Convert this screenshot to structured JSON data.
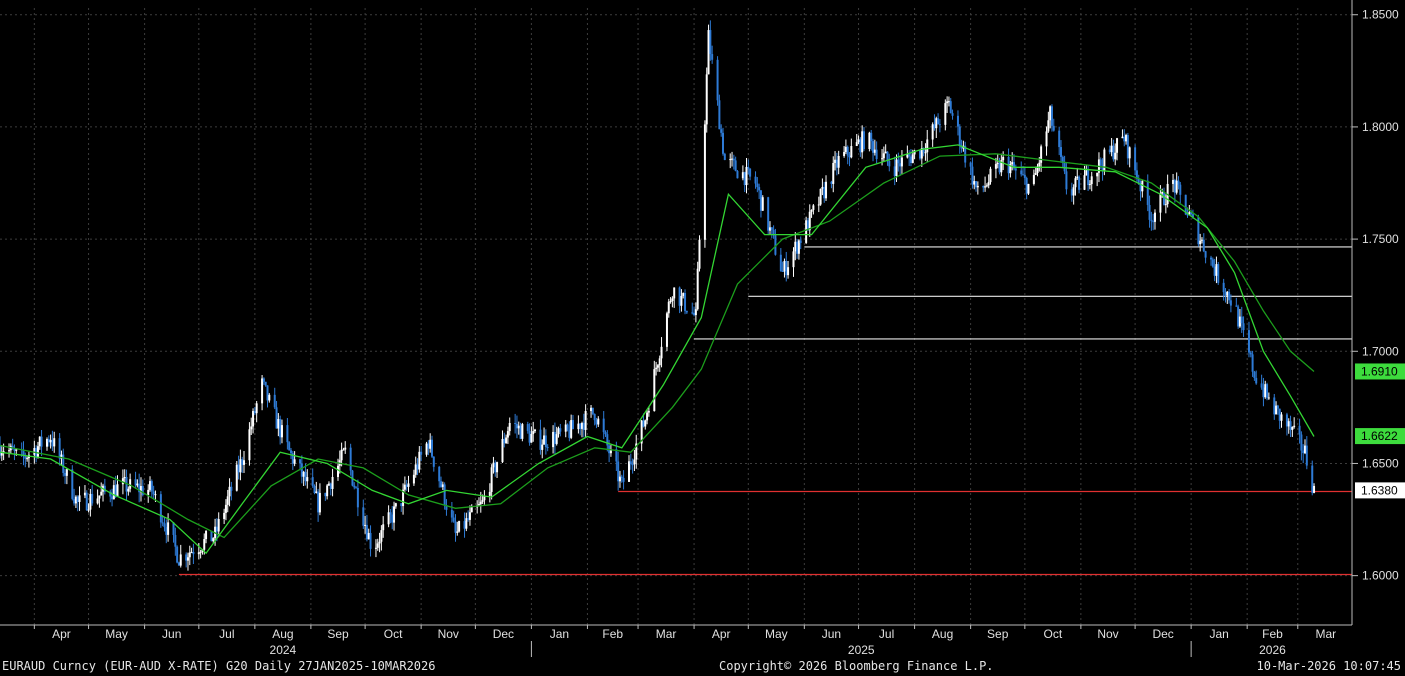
{
  "footer": {
    "left": "EURAUD Curncy (EUR-AUD X-RATE) G20 Daily 27JAN2025-10MAR2026",
    "center": "Copyright© 2026 Bloomberg Finance L.P.",
    "right": "10-Mar-2026 10:07:45"
  },
  "colors": {
    "background": "#000000",
    "grid": "#3c3c3c",
    "candle_up": "#ffffff",
    "candle_down": "#2e7bd6",
    "ma_fast": "#33d633",
    "ma_slow": "#1c9e1c",
    "support_white": "#e8e8e8",
    "support_red": "#e03030",
    "price_tag_green": "#3ddc3d",
    "price_tag_white": "#ffffff"
  },
  "chart_data": {
    "type": "candlestick",
    "ylim": [
      1.578,
      1.853
    ],
    "y_ticks": [
      "1.6000",
      "1.6500",
      "1.7000",
      "1.7500",
      "1.8000",
      "1.8500"
    ],
    "y_tick_values": [
      1.6,
      1.65,
      1.7,
      1.75,
      1.8,
      1.85
    ],
    "months": [
      "Apr",
      "May",
      "Jun",
      "Jul",
      "Aug",
      "Sep",
      "Oct",
      "Nov",
      "Dec",
      "Jan",
      "Feb",
      "Mar",
      "Apr",
      "May",
      "Jun",
      "Jul",
      "Aug",
      "Sep",
      "Oct",
      "Nov",
      "Dec",
      "Jan",
      "Feb",
      "Mar"
    ],
    "years": [
      "2024",
      "2025",
      "2026"
    ],
    "x_range": [
      "2024-03-13",
      "2026-03-31"
    ],
    "price_path": [
      [
        "2024-03-13",
        1.658
      ],
      [
        "2024-03-25",
        1.652
      ],
      [
        "2024-04-10",
        1.662
      ],
      [
        "2024-04-25",
        1.632
      ],
      [
        "2024-05-20",
        1.64
      ],
      [
        "2024-06-05",
        1.638
      ],
      [
        "2024-06-20",
        1.608
      ],
      [
        "2024-07-10",
        1.618
      ],
      [
        "2024-07-25",
        1.652
      ],
      [
        "2024-08-05",
        1.685
      ],
      [
        "2024-08-20",
        1.655
      ],
      [
        "2024-09-05",
        1.632
      ],
      [
        "2024-09-20",
        1.655
      ],
      [
        "2024-10-05",
        1.612
      ],
      [
        "2024-10-20",
        1.632
      ],
      [
        "2024-11-05",
        1.66
      ],
      [
        "2024-11-20",
        1.618
      ],
      [
        "2024-12-05",
        1.632
      ],
      [
        "2024-12-20",
        1.668
      ],
      [
        "2025-01-05",
        1.66
      ],
      [
        "2025-01-20",
        1.663
      ],
      [
        "2025-02-05",
        1.673
      ],
      [
        "2025-02-20",
        1.64
      ],
      [
        "2025-03-05",
        1.67
      ],
      [
        "2025-03-20",
        1.728
      ],
      [
        "2025-04-02",
        1.715
      ],
      [
        "2025-04-09",
        1.84
      ],
      [
        "2025-04-18",
        1.785
      ],
      [
        "2025-05-05",
        1.775
      ],
      [
        "2025-05-20",
        1.735
      ],
      [
        "2025-06-05",
        1.76
      ],
      [
        "2025-06-20",
        1.785
      ],
      [
        "2025-07-05",
        1.795
      ],
      [
        "2025-07-20",
        1.782
      ],
      [
        "2025-08-05",
        1.79
      ],
      [
        "2025-08-20",
        1.81
      ],
      [
        "2025-09-05",
        1.77
      ],
      [
        "2025-09-20",
        1.785
      ],
      [
        "2025-10-05",
        1.772
      ],
      [
        "2025-10-15",
        1.805
      ],
      [
        "2025-10-25",
        1.77
      ],
      [
        "2025-11-10",
        1.782
      ],
      [
        "2025-11-25",
        1.795
      ],
      [
        "2025-12-10",
        1.76
      ],
      [
        "2025-12-22",
        1.775
      ],
      [
        "2026-01-05",
        1.752
      ],
      [
        "2026-01-15",
        1.735
      ],
      [
        "2026-01-25",
        1.72
      ],
      [
        "2026-02-05",
        1.69
      ],
      [
        "2026-02-15",
        1.675
      ],
      [
        "2026-02-25",
        1.665
      ],
      [
        "2026-03-05",
        1.655
      ],
      [
        "2026-03-10",
        1.638
      ]
    ],
    "ma_fast": [
      [
        "2024-03-13",
        1.655
      ],
      [
        "2024-04-10",
        1.652
      ],
      [
        "2024-05-15",
        1.636
      ],
      [
        "2024-06-15",
        1.625
      ],
      [
        "2024-07-05",
        1.61
      ],
      [
        "2024-07-25",
        1.632
      ],
      [
        "2024-08-15",
        1.655
      ],
      [
        "2024-09-10",
        1.65
      ],
      [
        "2024-10-05",
        1.638
      ],
      [
        "2024-10-25",
        1.632
      ],
      [
        "2024-11-15",
        1.638
      ],
      [
        "2024-12-10",
        1.635
      ],
      [
        "2025-01-05",
        1.65
      ],
      [
        "2025-02-01",
        1.662
      ],
      [
        "2025-02-20",
        1.657
      ],
      [
        "2025-03-15",
        1.685
      ],
      [
        "2025-04-05",
        1.715
      ],
      [
        "2025-04-20",
        1.77
      ],
      [
        "2025-05-10",
        1.752
      ],
      [
        "2025-06-05",
        1.752
      ],
      [
        "2025-07-05",
        1.782
      ],
      [
        "2025-08-05",
        1.79
      ],
      [
        "2025-08-25",
        1.792
      ],
      [
        "2025-09-25",
        1.782
      ],
      [
        "2025-10-20",
        1.782
      ],
      [
        "2025-11-20",
        1.78
      ],
      [
        "2025-12-15",
        1.77
      ],
      [
        "2026-01-10",
        1.755
      ],
      [
        "2026-01-25",
        1.735
      ],
      [
        "2026-02-10",
        1.7
      ],
      [
        "2026-02-25",
        1.68
      ],
      [
        "2026-03-10",
        1.662
      ]
    ],
    "ma_slow": [
      [
        "2024-03-13",
        1.658
      ],
      [
        "2024-04-20",
        1.652
      ],
      [
        "2024-05-25",
        1.64
      ],
      [
        "2024-06-25",
        1.625
      ],
      [
        "2024-07-15",
        1.617
      ],
      [
        "2024-08-10",
        1.64
      ],
      [
        "2024-09-05",
        1.652
      ],
      [
        "2024-09-30",
        1.648
      ],
      [
        "2024-10-25",
        1.636
      ],
      [
        "2024-11-20",
        1.63
      ],
      [
        "2024-12-15",
        1.632
      ],
      [
        "2025-01-10",
        1.648
      ],
      [
        "2025-02-05",
        1.657
      ],
      [
        "2025-02-25",
        1.655
      ],
      [
        "2025-03-20",
        1.675
      ],
      [
        "2025-04-05",
        1.692
      ],
      [
        "2025-04-25",
        1.73
      ],
      [
        "2025-05-20",
        1.75
      ],
      [
        "2025-06-15",
        1.758
      ],
      [
        "2025-07-15",
        1.775
      ],
      [
        "2025-08-15",
        1.787
      ],
      [
        "2025-09-15",
        1.788
      ],
      [
        "2025-10-15",
        1.785
      ],
      [
        "2025-11-15",
        1.782
      ],
      [
        "2025-12-10",
        1.775
      ],
      [
        "2026-01-05",
        1.76
      ],
      [
        "2026-01-25",
        1.74
      ],
      [
        "2026-02-10",
        1.718
      ],
      [
        "2026-02-25",
        1.7
      ],
      [
        "2026-03-10",
        1.691
      ]
    ],
    "support_lines": [
      {
        "level": 1.7465,
        "from": "2025-06-01",
        "color": "white"
      },
      {
        "level": 1.7245,
        "from": "2025-05-01",
        "color": "white"
      },
      {
        "level": 1.7055,
        "from": "2025-04-01",
        "color": "white"
      },
      {
        "level": 1.6375,
        "from": "2025-02-18",
        "color": "red"
      },
      {
        "level": 1.6005,
        "from": "2024-06-20",
        "color": "red"
      }
    ],
    "price_labels": [
      {
        "value": "1.6910",
        "level": 1.691,
        "style": "green"
      },
      {
        "value": "1.6622",
        "level": 1.6622,
        "style": "green"
      },
      {
        "value": "1.6380",
        "level": 1.638,
        "style": "white"
      }
    ]
  }
}
